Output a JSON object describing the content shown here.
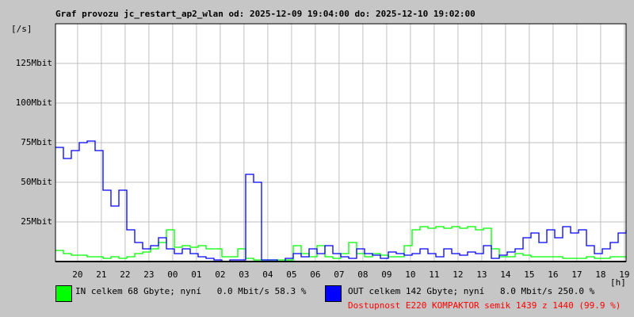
{
  "chart_data": {
    "type": "line",
    "title": "Graf provozu jc_restart_ap2_wlan od: 2025-12-09 19:04:00 do: 2025-12-10 19:02:00",
    "ylabel": "[/s]",
    "xlabel": "[h]",
    "ylim": [
      0,
      150
    ],
    "y_unit": "Mbit",
    "yticks": [
      {
        "value": 25,
        "label": "25Mbit"
      },
      {
        "value": 50,
        "label": "50Mbit"
      },
      {
        "value": 75,
        "label": "75Mbit"
      },
      {
        "value": 100,
        "label": "100Mbit"
      },
      {
        "value": 125,
        "label": "125Mbit"
      }
    ],
    "xticks": [
      "20",
      "21",
      "22",
      "23",
      "00",
      "01",
      "02",
      "03",
      "04",
      "05",
      "06",
      "07",
      "08",
      "09",
      "10",
      "11",
      "12",
      "13",
      "14",
      "15",
      "16",
      "17",
      "18",
      "19"
    ],
    "x_step_minutes": 20,
    "x_start_offset_hours": -0.93,
    "grid": true,
    "series": [
      {
        "name": "IN",
        "color": "#00ff00",
        "values": [
          7,
          5,
          4,
          4,
          3,
          3,
          2,
          3,
          2,
          3,
          5,
          6,
          8,
          12,
          20,
          9,
          10,
          9,
          10,
          8,
          8,
          3,
          3,
          8,
          2,
          1,
          1,
          1,
          1,
          1,
          10,
          5,
          3,
          10,
          3,
          2,
          5,
          12,
          5,
          3,
          5,
          4,
          3,
          3,
          10,
          20,
          22,
          21,
          22,
          21,
          22,
          21,
          22,
          20,
          21,
          8,
          3,
          3,
          5,
          4,
          3,
          3,
          3,
          3,
          2,
          2,
          2,
          3,
          2,
          2,
          3,
          3,
          2
        ]
      },
      {
        "name": "OUT",
        "color": "#0000ff",
        "values": [
          72,
          65,
          70,
          75,
          76,
          70,
          45,
          35,
          45,
          20,
          12,
          8,
          10,
          15,
          8,
          5,
          8,
          5,
          3,
          2,
          1,
          0,
          1,
          1,
          55,
          50,
          1,
          1,
          0,
          2,
          5,
          3,
          8,
          5,
          10,
          5,
          3,
          2,
          8,
          5,
          4,
          2,
          6,
          5,
          4,
          5,
          8,
          5,
          3,
          8,
          5,
          4,
          6,
          5,
          10,
          2,
          4,
          6,
          8,
          15,
          18,
          12,
          20,
          15,
          22,
          18,
          20,
          10,
          5,
          8,
          12,
          18,
          20
        ]
      }
    ]
  },
  "legend": {
    "in": {
      "color": "#00ff00",
      "text": "IN celkem 68 Gbyte; nyní   0.0 Mbit/s 58.3 %"
    },
    "out": {
      "color": "#0000ff",
      "text": "OUT celkem 142 Gbyte; nyní   8.0 Mbit/s 250.0 %"
    },
    "availability": "Dostupnost E220 KOMPAKTOR semik 1439 z 1440 (99.9 %)"
  }
}
